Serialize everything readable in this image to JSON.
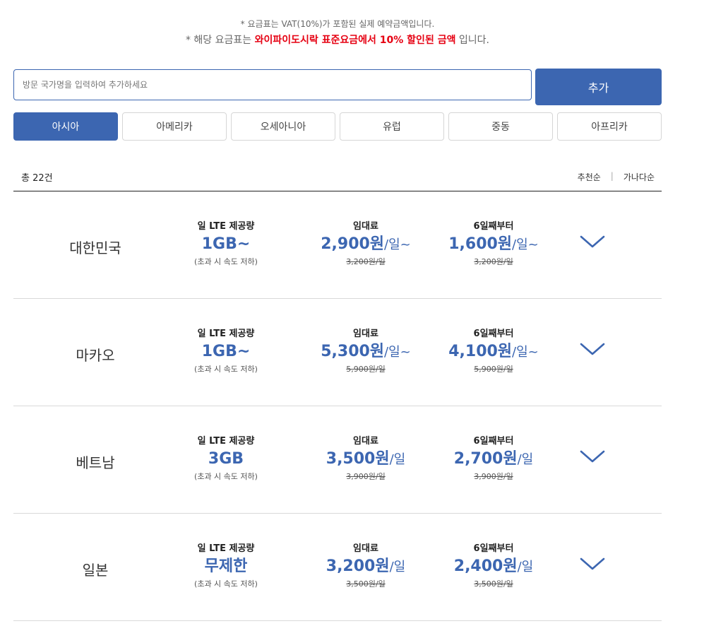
{
  "notice": {
    "line1": "* 요금표는 VAT(10%)가 포함된 실제 예약금액입니다.",
    "line2_prefix": "* 해당 요금표는 ",
    "line2_highlight": "와이파이도시락 표준요금에서 10% 할인된 금액",
    "line2_suffix": " 입니다."
  },
  "search": {
    "placeholder": "방문 국가명을 입력하여 추가하세요",
    "value": "",
    "add_label": "추가"
  },
  "tabs": [
    {
      "label": "아시아",
      "active": true
    },
    {
      "label": "아메리카",
      "active": false
    },
    {
      "label": "오세아니아",
      "active": false
    },
    {
      "label": "유럽",
      "active": false
    },
    {
      "label": "중동",
      "active": false
    },
    {
      "label": "아프리카",
      "active": false
    }
  ],
  "list": {
    "total": "총 22건",
    "sort_options": [
      "추천순",
      "가나다순"
    ],
    "sort_separator": "|"
  },
  "column_labels": {
    "data": "일 LTE 제공량",
    "rent": "임대료",
    "after": "6일째부터",
    "data_note": "(초과 시 속도 저하)"
  },
  "rows": [
    {
      "country": "대한민국",
      "data": "1GB~",
      "rent_price": "2,900원",
      "rent_unit": "/일~",
      "rent_original": "3,200원/일",
      "after_price": "1,600원",
      "after_unit": "/일~",
      "after_original": "3,200원/일"
    },
    {
      "country": "마카오",
      "data": "1GB~",
      "rent_price": "5,300원",
      "rent_unit": "/일~",
      "rent_original": "5,900원/일",
      "after_price": "4,100원",
      "after_unit": "/일~",
      "after_original": "5,900원/일"
    },
    {
      "country": "베트남",
      "data": "3GB",
      "rent_price": "3,500원",
      "rent_unit": "/일",
      "rent_original": "3,900원/일",
      "after_price": "2,700원",
      "after_unit": "/일",
      "after_original": "3,900원/일"
    },
    {
      "country": "일본",
      "data": "무제한",
      "rent_price": "3,200원",
      "rent_unit": "/일",
      "rent_original": "3,500원/일",
      "after_price": "2,400원",
      "after_unit": "/일",
      "after_original": "3,500원/일"
    }
  ],
  "icons": {
    "expand": "chevron-down-icon"
  },
  "colors": {
    "accent": "#3c66b1",
    "highlight": "#e60012",
    "divider": "#d9d9d9"
  }
}
